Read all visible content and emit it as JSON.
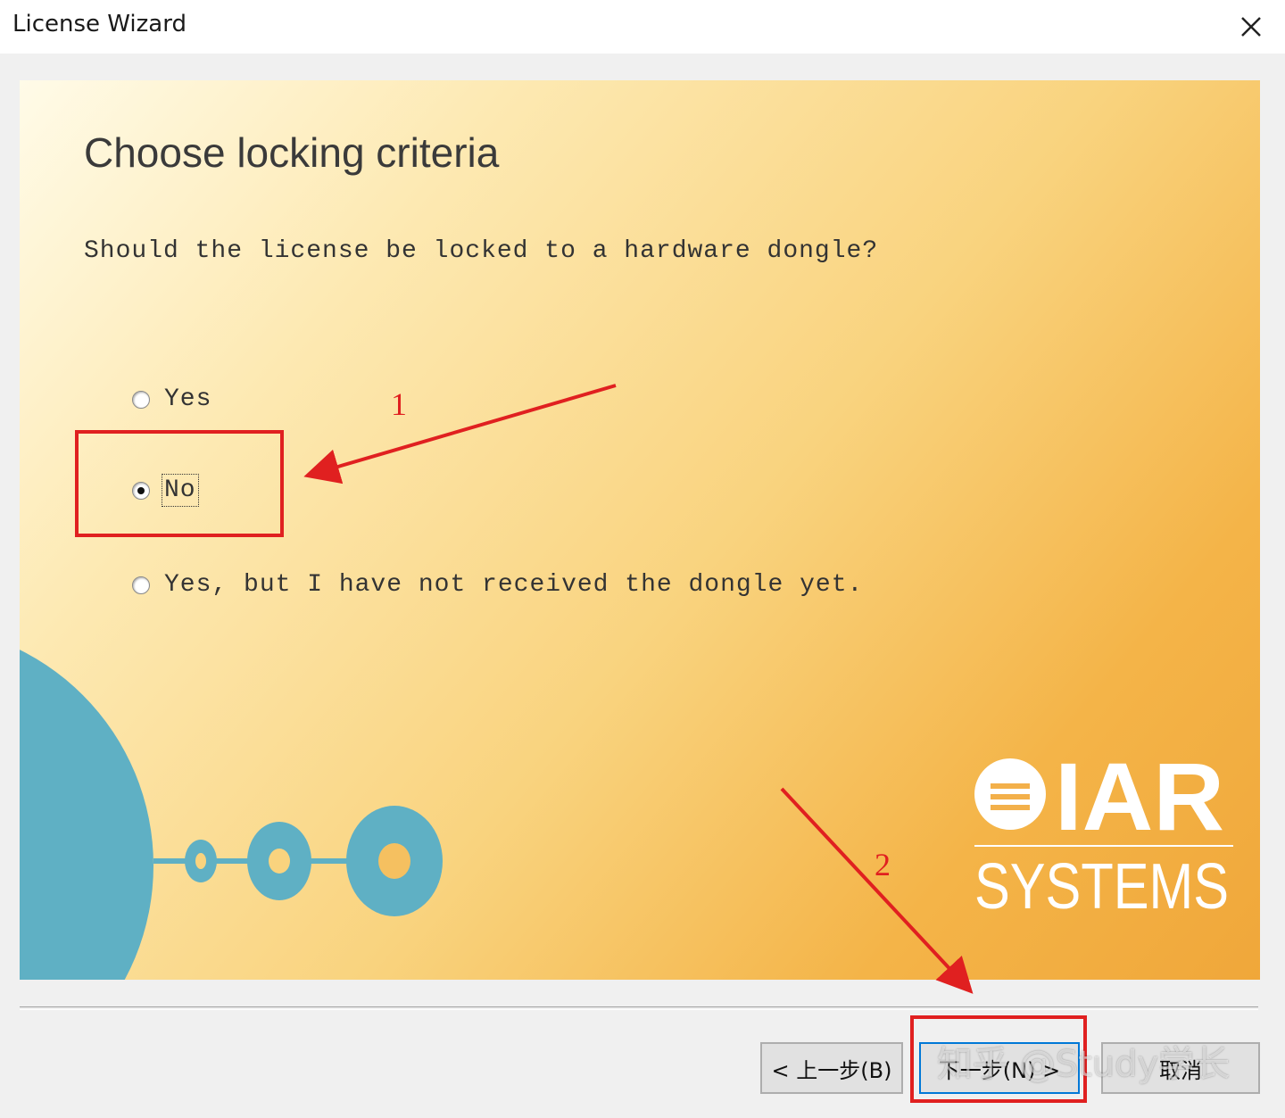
{
  "window": {
    "title": "License Wizard"
  },
  "page": {
    "heading": "Choose locking criteria",
    "question": "Should the license be locked to a hardware dongle?"
  },
  "options": [
    {
      "label": "Yes",
      "checked": false
    },
    {
      "label": "No",
      "checked": true
    },
    {
      "label": "Yes, but I have not received the dongle yet.",
      "checked": false
    }
  ],
  "buttons": {
    "back": "< 上一步(B)",
    "next": "下一步(N) >",
    "cancel": "取消"
  },
  "annotations": {
    "step1": "1",
    "step2": "2",
    "color": "#e02020"
  },
  "logo": {
    "line1": "IAR",
    "line2": "SYSTEMS"
  },
  "watermark": "知乎 @Study学长",
  "colors": {
    "panel_gradient_start": "#fffbe8",
    "panel_gradient_end": "#f0a73a",
    "deco_teal": "#5fb0c4"
  }
}
